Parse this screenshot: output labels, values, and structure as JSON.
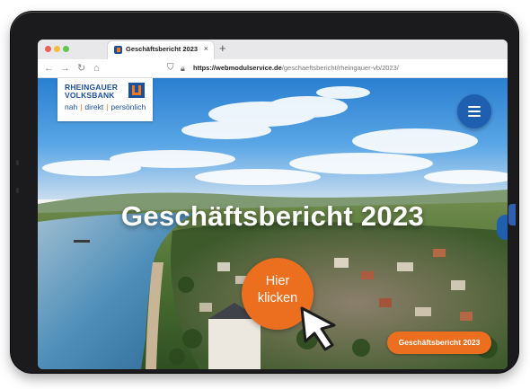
{
  "browser": {
    "tab_title": "Geschäftsbericht 2023",
    "tab_close": "×",
    "new_tab": "+",
    "url_domain": "https://webmodulservice.de",
    "url_path": "/geschaeftsbericht/rheingauer-vb/2023/",
    "nav_icons": [
      "arrow-left-icon",
      "arrow-right-icon",
      "reload-icon",
      "home-icon",
      "shield-icon",
      "lock-icon"
    ]
  },
  "logo": {
    "line1": "RHEINGAUER",
    "line2": "VOLKSBANK",
    "tagline_1": "nah",
    "tagline_2": "direkt",
    "tagline_3": "persönlich",
    "separator": "|"
  },
  "hero": {
    "headline": "Geschäftsbericht 2023",
    "cta_line1": "Hier",
    "cta_line2": "klicken",
    "report_button": "Geschäftsbericht 2023"
  },
  "colors": {
    "brand_blue": "#1a4f9c",
    "accent_orange": "#ec6e1f",
    "menu_blue": "#1f5fb0"
  }
}
